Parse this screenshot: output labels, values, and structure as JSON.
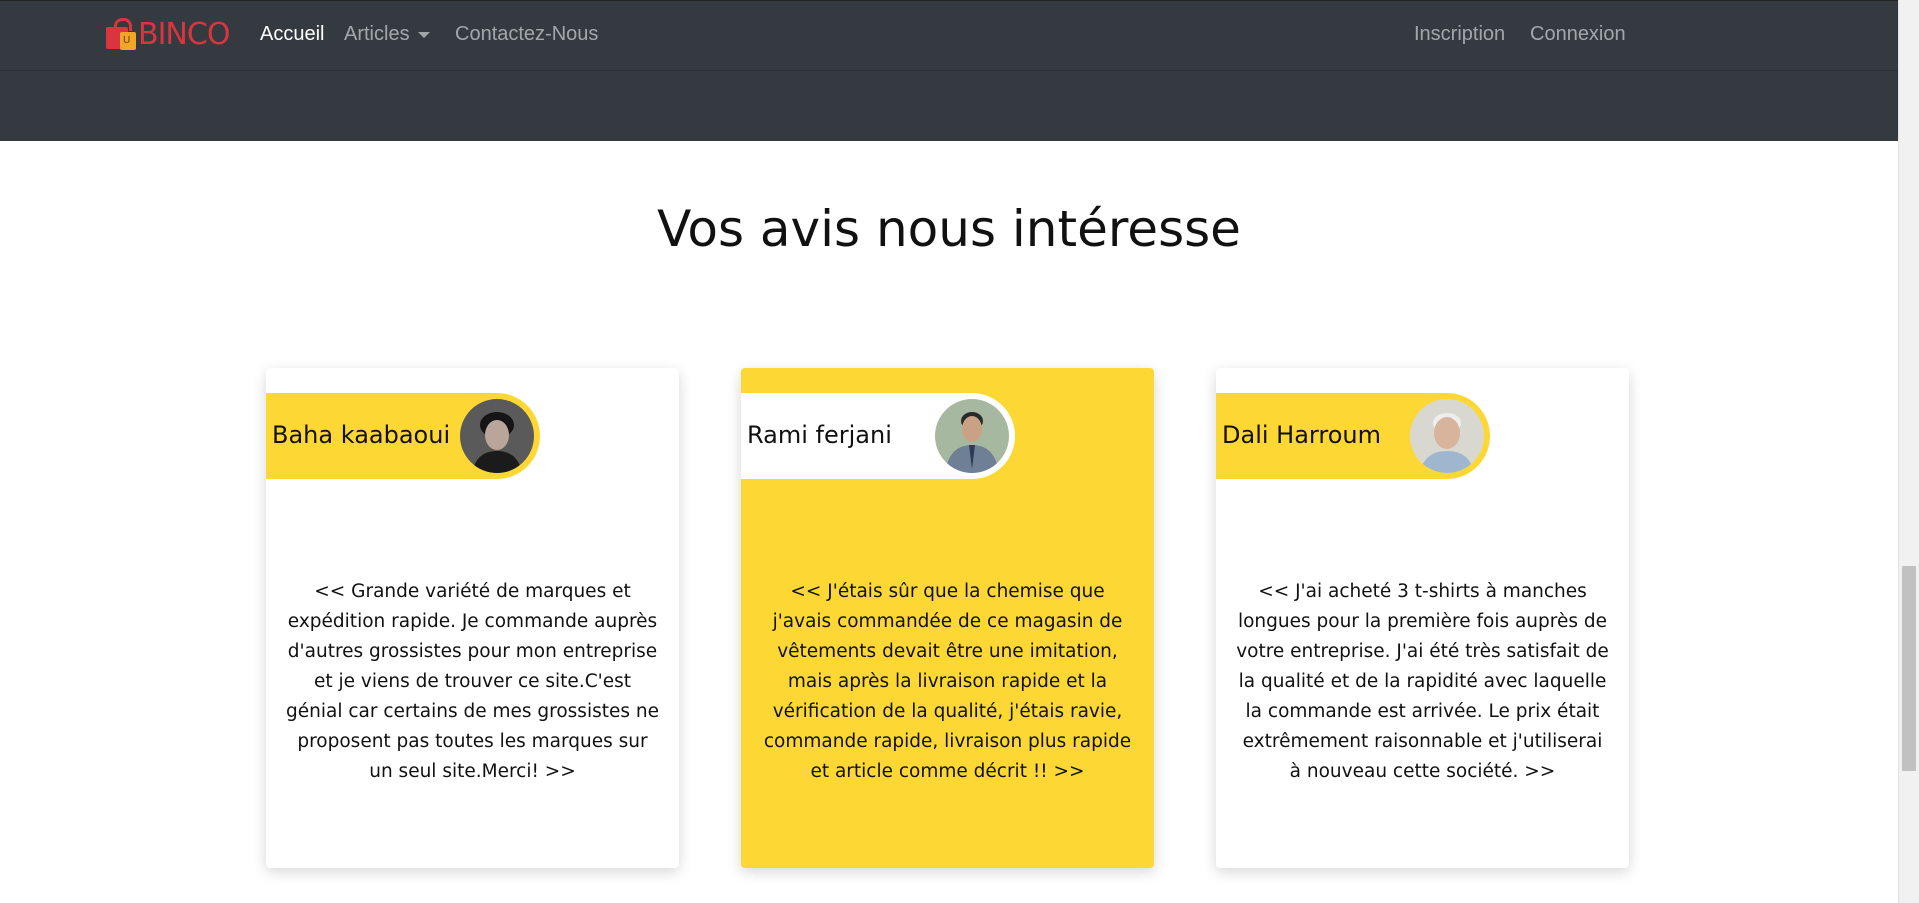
{
  "navbar": {
    "brand_text": "BINCO",
    "brand_bag_letter": "U",
    "links": {
      "home": "Accueil",
      "articles": "Articles",
      "contact": "Contactez-Nous",
      "signup": "Inscription",
      "login": "Connexion"
    }
  },
  "testimonials": {
    "title": "Vos avis nous intéresse",
    "items": [
      {
        "name": "Baha kaabaoui",
        "text": "<< Grande variété de marques et expédition rapide. Je commande auprès d'autres grossistes pour mon entreprise et je viens de trouver ce site.C'est génial car certains de mes grossistes ne proposent pas toutes les marques sur un seul site.Merci! >>"
      },
      {
        "name": "Rami ferjani",
        "text": "<< J'étais sûr que la chemise que j'avais commandée de ce magasin de vêtements devait être une imitation, mais après la livraison rapide et la vérification de la qualité, j'étais ravie, commande rapide, livraison plus rapide et article comme décrit !! >>"
      },
      {
        "name": "Dali Harroum",
        "text": "<< J'ai acheté 3 t-shirts à manches longues pour la première fois auprès de votre entreprise. J'ai été très satisfait de la qualité et de la rapidité avec laquelle la commande est arrivée. Le prix était extrêmement raisonnable et j'utiliserai à nouveau cette société. >>"
      }
    ]
  },
  "colors": {
    "navbar_bg": "#343a40",
    "accent_yellow": "#fdd835",
    "brand_red": "#d9353f"
  }
}
